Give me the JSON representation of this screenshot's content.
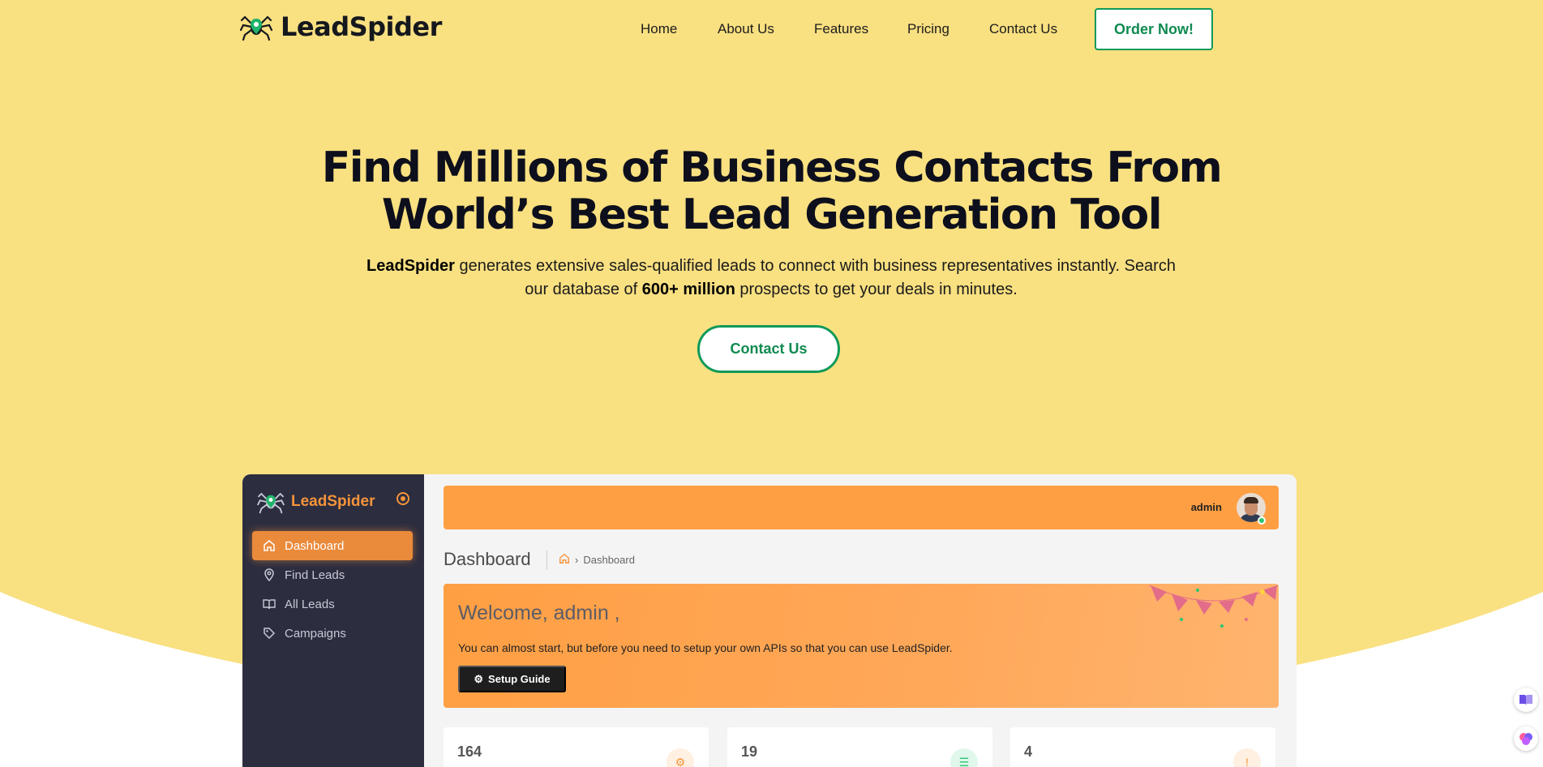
{
  "nav": {
    "brand": "LeadSpider",
    "links": [
      "Home",
      "About Us",
      "Features",
      "Pricing",
      "Contact Us"
    ],
    "cta": "Order Now!"
  },
  "hero": {
    "title_line1": "Find Millions of Business Contacts From",
    "title_line2": "World’s Best Lead Generation Tool",
    "sub_bold1": "LeadSpider",
    "sub_text1": " generates extensive sales-qualified leads to connect with business representatives instantly. Search our database of ",
    "sub_bold2": "600+ million",
    "sub_text2": " prospects to get your deals in minutes.",
    "cta": "Contact Us"
  },
  "dashboard": {
    "brand": "LeadSpider",
    "menu": [
      {
        "label": "Dashboard",
        "icon": "home-icon"
      },
      {
        "label": "Find Leads",
        "icon": "map-pin-icon"
      },
      {
        "label": "All Leads",
        "icon": "book-icon"
      },
      {
        "label": "Campaigns",
        "icon": "tag-icon"
      }
    ],
    "user": "admin",
    "page_title": "Dashboard",
    "breadcrumb": "Dashboard",
    "welcome_title": "Welcome, admin ,",
    "welcome_text": "You can almost start, but before you need to setup your own APIs so that you can use LeadSpider.",
    "setup_label": "Setup Guide",
    "stats": [
      "164",
      "19",
      "4"
    ]
  },
  "colors": {
    "hero_bg": "#f9e081",
    "brand_green": "#0f9a5a",
    "accent_orange": "#ff9f43",
    "sidebar": "#2c2d3f"
  }
}
